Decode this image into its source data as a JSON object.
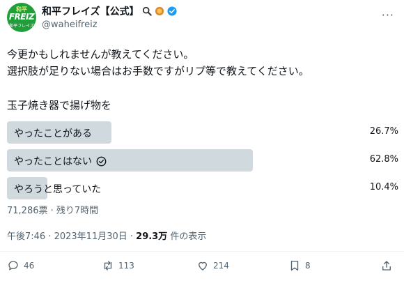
{
  "author": {
    "display_name": "和平フレイズ【公式】",
    "handle": "@waheifreiz",
    "avatar_top": "和平",
    "avatar_mid": "FREIZ",
    "avatar_bot": "和平フレイズ"
  },
  "tweet": {
    "text": "今更かもしれませんが教えてください。\n選択肢が足りない場合はお手数ですがリプ等で教えてください。",
    "poll_question": "玉子焼き器で揚げ物を"
  },
  "poll": {
    "options": [
      {
        "label": "やったことがある",
        "percent": "26.7%",
        "share": 0.267
      },
      {
        "label": "やったことはない",
        "percent": "62.8%",
        "share": 0.628,
        "voted": true
      },
      {
        "label": "やろうと思っていた",
        "percent": "10.4%",
        "share": 0.104
      }
    ],
    "meta": "71,286票 · 残り7時間"
  },
  "timestamp": {
    "time": "午後7:46 · 2023年11月30日 · ",
    "views_count": "29.3万",
    "views_label": " 件の表示"
  },
  "actions": {
    "replies": "46",
    "reposts": "113",
    "likes": "214",
    "bookmarks": "8"
  },
  "colors": {
    "bar": "#cfd9de",
    "verified": "#1d9bf0",
    "avatar": "#1f9e3a"
  }
}
